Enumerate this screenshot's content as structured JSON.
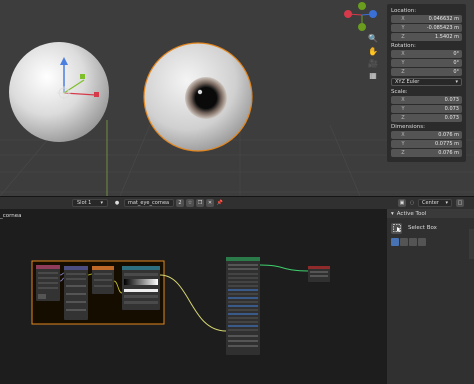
{
  "viewport": {
    "gizmo": {
      "x": "X",
      "y": "Y",
      "z": "Z"
    }
  },
  "transform": {
    "location_label": "Location:",
    "location": [
      {
        "axis": "X",
        "value": "0.046632 m"
      },
      {
        "axis": "Y",
        "value": "-0.085423 m"
      },
      {
        "axis": "Z",
        "value": "1.5402 m"
      }
    ],
    "rotation_label": "Rotation:",
    "rotation": [
      {
        "axis": "X",
        "value": "0°"
      },
      {
        "axis": "Y",
        "value": "0°"
      },
      {
        "axis": "Z",
        "value": "0°"
      }
    ],
    "rotation_mode": "XYZ Euler",
    "scale_label": "Scale:",
    "scale": [
      {
        "axis": "X",
        "value": "0.073"
      },
      {
        "axis": "Y",
        "value": "0.073"
      },
      {
        "axis": "Z",
        "value": "0.073"
      }
    ],
    "dimensions_label": "Dimensions:",
    "dimensions": [
      {
        "axis": "X",
        "value": "0.076 m"
      },
      {
        "axis": "Y",
        "value": "0.0775 m"
      },
      {
        "axis": "Z",
        "value": "0.076 m"
      }
    ]
  },
  "node_header": {
    "slot": "Slot 1",
    "material": "mat_eye_cornea",
    "users": "2",
    "pivot": "Center"
  },
  "node_editor": {
    "breadcrumb": "_cornea"
  },
  "tool_panel": {
    "title": "Active Tool",
    "tool_name": "Select Box"
  },
  "colors": {
    "viewport_bg": "#3d3d3d",
    "editor_bg": "#1d1d1d",
    "selection_orange": "#e3861e",
    "accent_blue": "#4772b3",
    "axis_x": "#e0394b",
    "axis_y": "#6a9c1e",
    "axis_z": "#3a6fd6"
  }
}
